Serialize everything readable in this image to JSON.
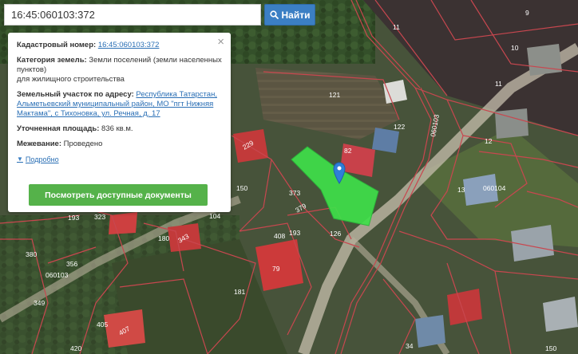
{
  "search": {
    "value": "16:45:060103:372",
    "button_label": "Найти"
  },
  "info_card": {
    "cadastral_label": "Кадастровый номер:",
    "cadastral_value": "16:45:060103:372",
    "category_label": "Категория земель:",
    "category_value": "Земли поселений (земли населенных пунктов)",
    "category_value_2": "для жилищного строительства",
    "address_label": "Земельный участок по адресу:",
    "address_value": "Республика Татарстан, Альметьевский муниципальный район, МО \"пгт Нижняя Мактама\", с Тихоновка, ул. Речная, д. 17",
    "area_label": "Уточненная площадь:",
    "area_value": "836 кв.м.",
    "survey_label": "Межевание:",
    "survey_value": "Проведено",
    "more_label": "Подробно",
    "docs_button": "Посмотреть доступные документы",
    "close_symbol": "×"
  },
  "map_labels": {
    "n9": "9",
    "n10": "10",
    "n11a": "11",
    "n11b": "11",
    "n12": "12",
    "n13": "13",
    "n121": "121",
    "n122": "122",
    "n82": "82",
    "n229": "229",
    "n150": "150",
    "n373": "373",
    "n379": "379",
    "n193": "193",
    "n408": "408",
    "n126": "126",
    "n104": "104",
    "n323": "323",
    "n193b": "193",
    "n180": "180",
    "n343": "343",
    "n380": "380",
    "n356": "356",
    "n79": "79",
    "n181": "181",
    "n349": "349",
    "n405": "405",
    "n407": "407",
    "n420": "420",
    "n34": "34",
    "n150b": "150",
    "block_060103": "060103",
    "block_060104": "060104",
    "block_060103v": "060103"
  },
  "colors": {
    "parcel_fill": "#3fe04a",
    "boundary": "#c8474f",
    "road": "#c7bfae",
    "button_blue": "#3b7fc4",
    "button_green": "#55b24a"
  }
}
